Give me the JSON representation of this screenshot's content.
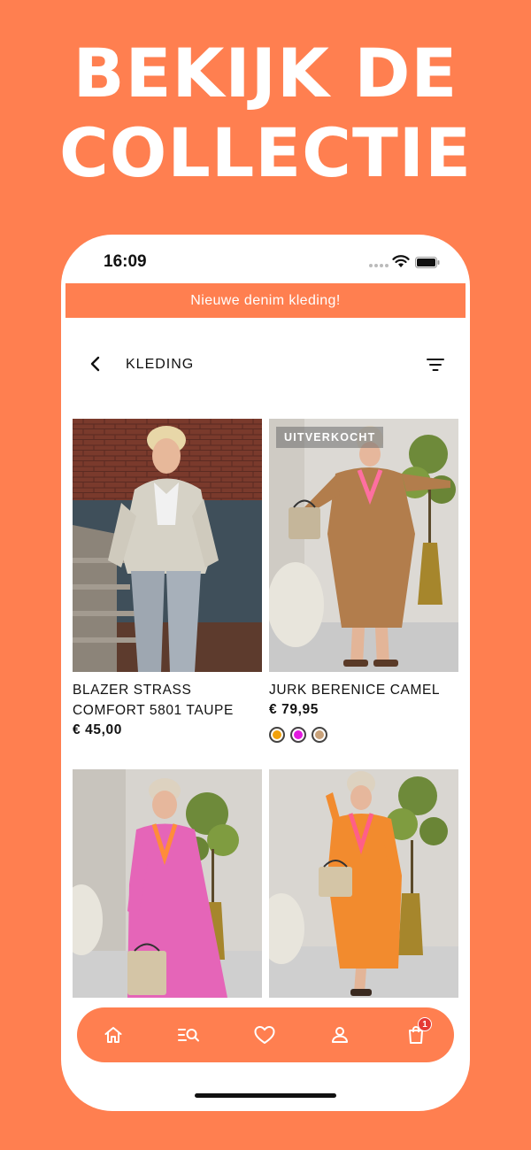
{
  "colors": {
    "accent": "#FF7F50",
    "cart_badge": "#E53935"
  },
  "headline": {
    "line1": "BEKIJK DE",
    "line2": "COLLECTIE"
  },
  "status_bar": {
    "time": "16:09"
  },
  "announcement": "Nieuwe denim kleding!",
  "header": {
    "title": "KLEDING"
  },
  "products": [
    {
      "name": "BLAZER STRASS COMFORT 5801 TAUPE",
      "price": "€ 45,00",
      "badge": ""
    },
    {
      "name": "JURK BERENICE CAMEL",
      "price": "€ 79,95",
      "badge": "UITVERKOCHT",
      "swatches": [
        "#F2A20C",
        "#E31AE0",
        "#C9A27A"
      ]
    },
    {
      "name": "",
      "price": "",
      "badge": ""
    },
    {
      "name": "",
      "price": "",
      "badge": ""
    }
  ],
  "bottom_nav": {
    "items": [
      "home-icon",
      "search-list-icon",
      "heart-icon",
      "user-icon",
      "cart-icon"
    ],
    "cart_count": "1"
  }
}
